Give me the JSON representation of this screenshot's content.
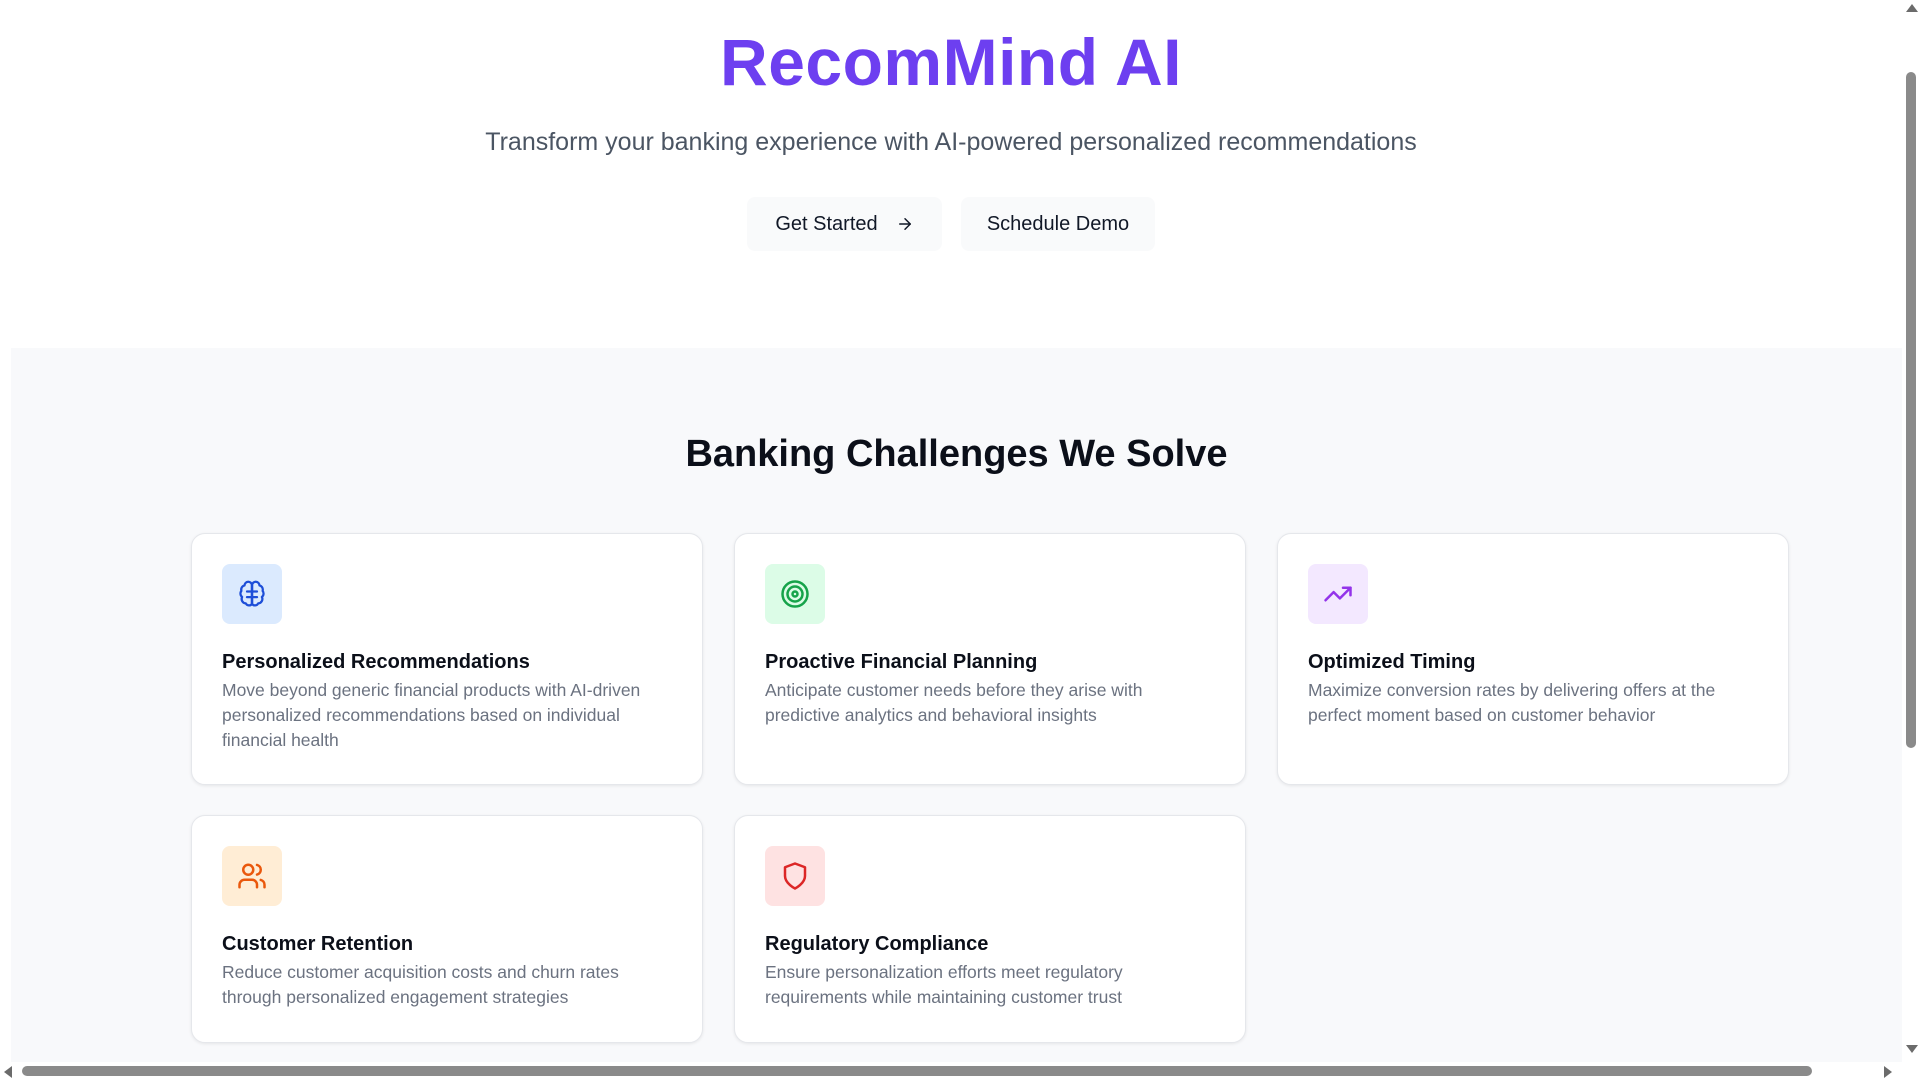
{
  "hero": {
    "title": "RecomMind AI",
    "subtitle": "Transform your banking experience with AI-powered personalized recommendations",
    "primary_button": {
      "label": "Get Started",
      "icon": "arrow-right-icon"
    },
    "secondary_button": {
      "label": "Schedule Demo"
    }
  },
  "challenges": {
    "title": "Banking Challenges We Solve",
    "cards": [
      {
        "title": "Personalized Recommendations",
        "description": "Move beyond generic financial products with AI-driven personalized recommendations based on individual financial health",
        "icon": "brain-icon",
        "icon_color": "#1d4ed8",
        "icon_bg": "#dbeafe"
      },
      {
        "title": "Proactive Financial Planning",
        "description": "Anticipate customer needs before they arise with predictive analytics and behavioral insights",
        "icon": "target-icon",
        "icon_color": "#16a34a",
        "icon_bg": "#dcfce7"
      },
      {
        "title": "Optimized Timing",
        "description": "Maximize conversion rates by delivering offers at the perfect moment based on customer behavior",
        "icon": "trending-up-icon",
        "icon_color": "#9333ea",
        "icon_bg": "#f3e8ff"
      },
      {
        "title": "Customer Retention",
        "description": "Reduce customer acquisition costs and churn rates through personalized engagement strategies",
        "icon": "users-icon",
        "icon_color": "#ea580c",
        "icon_bg": "#ffedd5"
      },
      {
        "title": "Regulatory Compliance",
        "description": "Ensure personalization efforts meet regulatory requirements while maintaining customer trust",
        "icon": "shield-icon",
        "icon_color": "#dc2626",
        "icon_bg": "#fee2e2"
      }
    ]
  },
  "colors": {
    "brand": "#6d3ff0",
    "section_bg": "#f8f9fb"
  }
}
